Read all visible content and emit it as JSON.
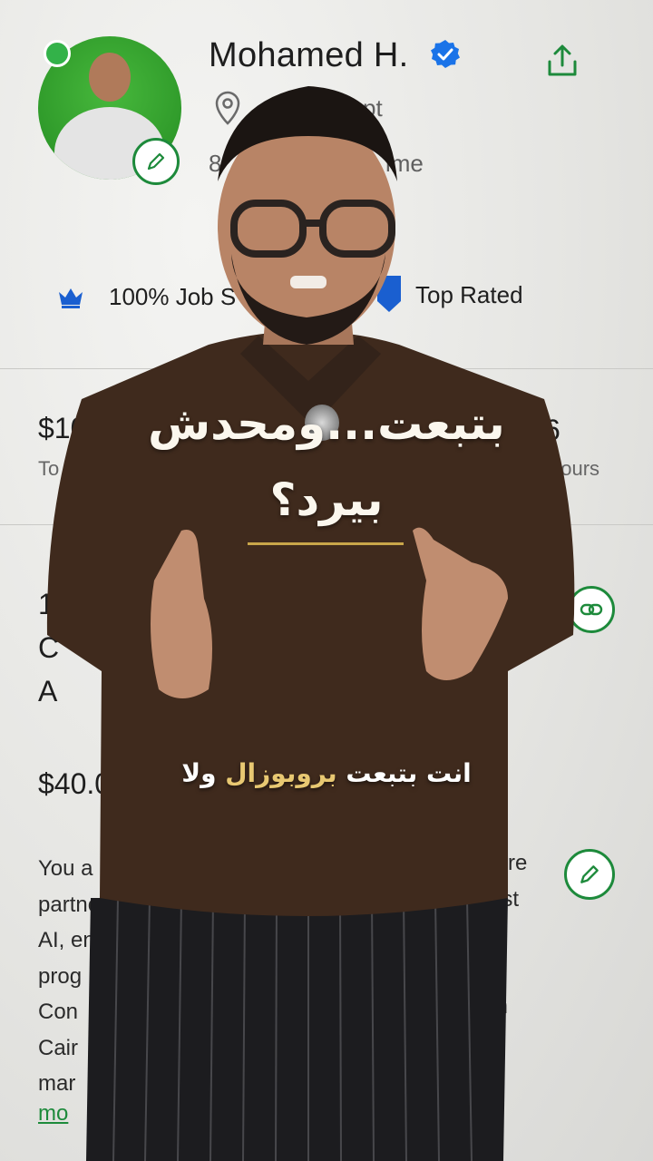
{
  "profile": {
    "name": "Mohamed H.",
    "location": "Egypt",
    "location_visible": "pt",
    "local_time_prefix": "8",
    "local_time_suffix": "ime",
    "job_success": "100% Job S",
    "top_rated": "Top Rated",
    "icons": {
      "verified": "verified-check-icon",
      "share": "share-icon",
      "edit": "pencil-icon",
      "link": "link-icon",
      "location": "location-pin-icon",
      "crown": "crown-icon"
    },
    "colors": {
      "accent_green": "#1d8a3b",
      "verified_blue": "#1a73e8"
    }
  },
  "stats": {
    "rate_partial": "$10",
    "rate_label_partial": "To",
    "right_partial": "6",
    "hours_label": "hours"
  },
  "listing": {
    "title_line1": "1",
    "title_line2": "C",
    "title_line3": "A",
    "price_partial": "$40.00",
    "bio_left": "You a\npartne\nAI, en\nprog\nCon\nCair\nmar",
    "bio_right1": "re",
    "bio_right2": "est",
    "bio_right3": "m",
    "more_label": "mo"
  },
  "captions": {
    "line1": "بتبعت...ومحدش",
    "line2": "بيرد؟",
    "line3_part1": "انت بتبعت",
    "line3_highlight": "بروبوزال",
    "line3_part2": "ولا",
    "highlight_color": "#e8c872",
    "underline_color": "#c9a64a"
  }
}
